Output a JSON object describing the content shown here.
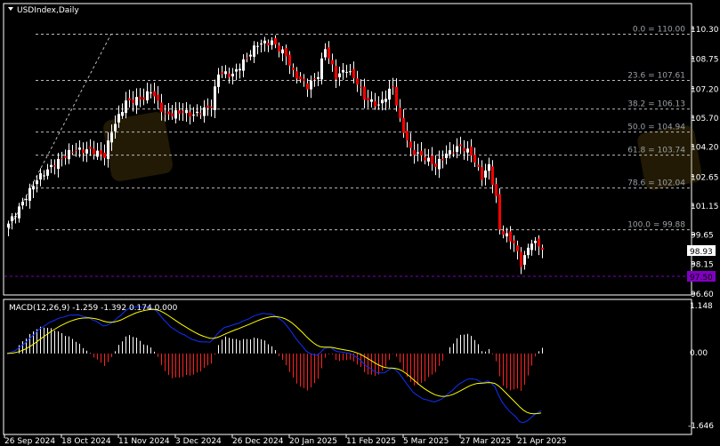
{
  "header": {
    "symbol_title": "USDIndex,Daily"
  },
  "price_axis": {
    "labels": [
      "110.30",
      "108.75",
      "107.20",
      "105.70",
      "104.20",
      "102.65",
      "101.15",
      "99.65",
      "98.15",
      "96.60"
    ],
    "current_price": "98.93",
    "marked_price": "97.50",
    "marked_color": "#8000c0"
  },
  "fibonacci": [
    {
      "label": "0.0 = 110.00",
      "price": 110.0
    },
    {
      "label": "23.6 = 107.61",
      "price": 107.61
    },
    {
      "label": "38.2 = 106.13",
      "price": 106.13
    },
    {
      "label": "50.0 = 104.94",
      "price": 104.94
    },
    {
      "label": "61.8 = 103.74",
      "price": 103.74
    },
    {
      "label": "78.6 = 102.04",
      "price": 102.04
    },
    {
      "label": "100.0 = 99.88",
      "price": 99.88
    }
  ],
  "macd": {
    "label": "MACD(12,26,9) -1.259 -1.392 0.174 0.000",
    "axis_labels": [
      "1.148",
      "0.00",
      "-1.646"
    ],
    "range": [
      -1.646,
      1.148
    ]
  },
  "date_labels": [
    "26 Sep 2024",
    "18 Oct 2024",
    "11 Nov 2024",
    "3 Dec 2024",
    "26 Dec 2024",
    "20 Jan 2025",
    "11 Feb 2025",
    "5 Mar 2025",
    "27 Mar 2025",
    "21 Apr 2025"
  ],
  "chart_data": {
    "type": "candlestick",
    "title": "USDIndex,Daily",
    "ylim": [
      96.6,
      110.3
    ],
    "close_waypoints": [
      [
        0,
        100.2
      ],
      [
        3,
        101.0
      ],
      [
        8,
        102.5
      ],
      [
        13,
        103.3
      ],
      [
        18,
        104.0
      ],
      [
        23,
        104.0
      ],
      [
        27,
        103.7
      ],
      [
        29,
        105.0
      ],
      [
        33,
        106.5
      ],
      [
        38,
        106.7
      ],
      [
        40,
        107.1
      ],
      [
        44,
        105.8
      ],
      [
        49,
        106.0
      ],
      [
        52,
        105.8
      ],
      [
        57,
        106.3
      ],
      [
        59,
        108.0
      ],
      [
        63,
        107.9
      ],
      [
        67,
        108.8
      ],
      [
        70,
        109.5
      ],
      [
        74,
        109.6
      ],
      [
        78,
        108.9
      ],
      [
        80,
        108.0
      ],
      [
        84,
        107.3
      ],
      [
        87,
        107.9
      ],
      [
        89,
        109.3
      ],
      [
        92,
        107.8
      ],
      [
        95,
        108.2
      ],
      [
        98,
        107.5
      ],
      [
        100,
        106.7
      ],
      [
        104,
        106.3
      ],
      [
        108,
        107.3
      ],
      [
        110,
        105.5
      ],
      [
        113,
        104.0
      ],
      [
        117,
        103.6
      ],
      [
        120,
        103.2
      ],
      [
        123,
        103.8
      ],
      [
        127,
        104.2
      ],
      [
        130,
        103.8
      ],
      [
        133,
        102.6
      ],
      [
        135,
        103.2
      ],
      [
        137,
        101.5
      ],
      [
        138,
        99.9
      ],
      [
        142,
        99.2
      ],
      [
        144,
        98.1
      ],
      [
        147,
        99.3
      ],
      [
        150,
        98.93
      ]
    ]
  }
}
